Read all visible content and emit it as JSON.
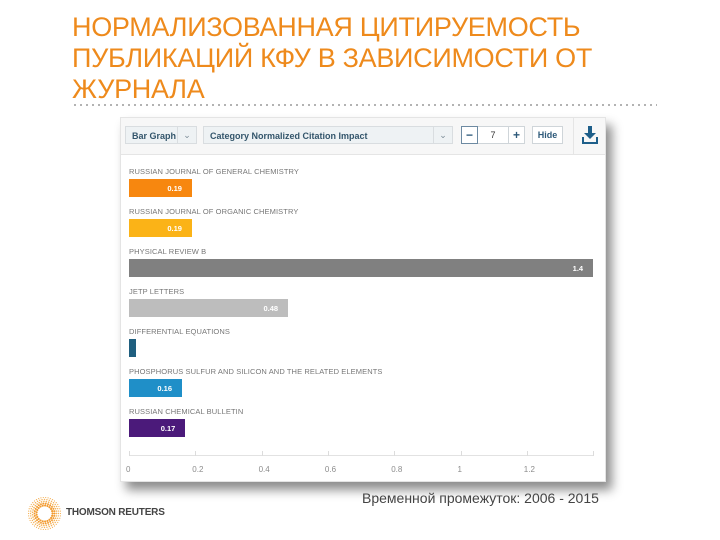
{
  "slide": {
    "title_lines": [
      "НОРМАЛИЗОВАННАЯ ЦИТИРУЕМОСТЬ",
      "ПУБЛИКАЦИЙ КФУ В ЗАВИСИМОСТИ ОТ",
      "ЖУРНАЛА"
    ],
    "period": "Временной промежуток: 2006 - 2015",
    "logo_text": "THOMSON REUTERS",
    "accent_color": "#ee8a1c"
  },
  "toolbar": {
    "chart_type": "Bar Graph",
    "metric": "Category Normalized Citation Impact",
    "count": "7",
    "minus_label": "−",
    "plus_label": "+",
    "hide_label": "Hide",
    "download_icon": "download-icon"
  },
  "chart_data": {
    "type": "bar",
    "orientation": "horizontal",
    "title": "Category Normalized Citation Impact",
    "xlabel": "",
    "ylabel": "",
    "xlim": [
      0,
      1.4
    ],
    "grid": false,
    "categories": [
      "RUSSIAN JOURNAL OF GENERAL CHEMISTRY",
      "RUSSIAN JOURNAL OF ORGANIC CHEMISTRY",
      "PHYSICAL REVIEW B",
      "JETP LETTERS",
      "DIFFERENTIAL EQUATIONS",
      "PHOSPHORUS SULFUR AND SILICON AND THE RELATED ELEMENTS",
      "RUSSIAN CHEMICAL BULLETIN"
    ],
    "values": [
      0.19,
      0.19,
      1.4,
      0.48,
      0.02,
      0.16,
      0.17
    ],
    "value_labels": [
      "0.19",
      "0.19",
      "1.4",
      "0.48",
      "",
      "0.16",
      "0.17"
    ],
    "colors": [
      "#f7870f",
      "#fbb317",
      "#808080",
      "#bdbdbd",
      "#1f5f7f",
      "#1f8fc8",
      "#4b1a7a"
    ],
    "x_ticks": [
      0,
      0.2,
      0.4,
      0.6,
      0.8,
      1,
      1.2
    ],
    "x_tick_labels": [
      "0",
      "0.2",
      "0.4",
      "0.6",
      "0.8",
      "1",
      "1.2"
    ]
  }
}
